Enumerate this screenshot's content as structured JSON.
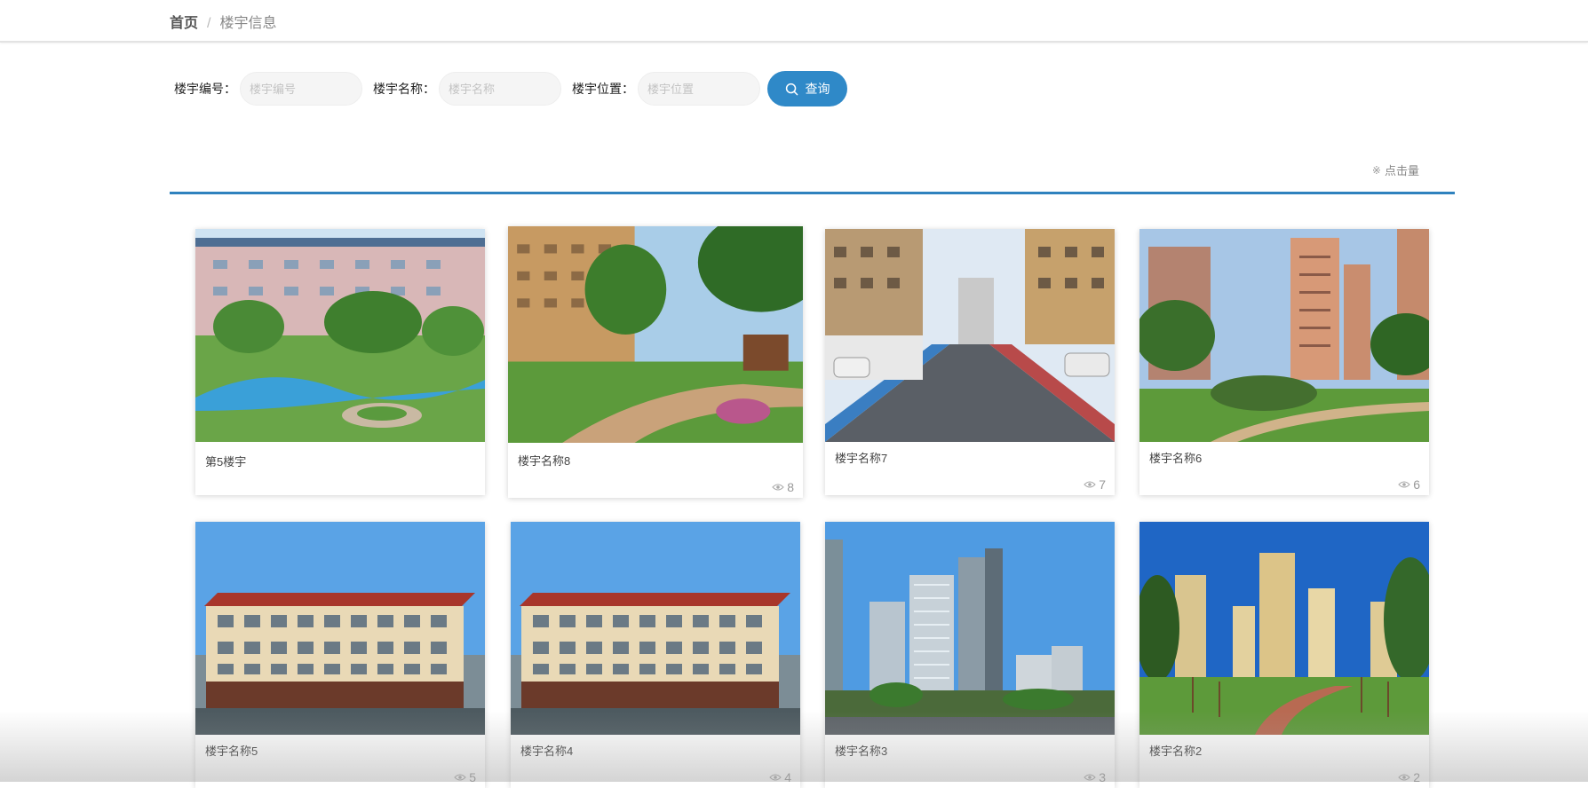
{
  "breadcrumb": {
    "home": "首页",
    "separator": "/",
    "current": "楼宇信息"
  },
  "search": {
    "fields": [
      {
        "label": "楼宇编号：",
        "placeholder": "楼宇编号",
        "value": ""
      },
      {
        "label": "楼宇名称：",
        "placeholder": "楼宇名称",
        "value": ""
      },
      {
        "label": "楼宇位置：",
        "placeholder": "楼宇位置",
        "value": ""
      }
    ],
    "button_label": "查询"
  },
  "sort": {
    "mark": "※",
    "label": "点击量"
  },
  "cards": [
    {
      "title": "第5楼宇",
      "views": ""
    },
    {
      "title": "楼宇名称8",
      "views": "8"
    },
    {
      "title": "楼宇名称7",
      "views": "7"
    },
    {
      "title": "楼宇名称6",
      "views": "6"
    },
    {
      "title": "楼宇名称5",
      "views": "5"
    },
    {
      "title": "楼宇名称4",
      "views": "4"
    },
    {
      "title": "楼宇名称3",
      "views": "3"
    },
    {
      "title": "楼宇名称2",
      "views": "2"
    }
  ],
  "colors": {
    "accent": "#2f89c8",
    "divider": "#2f82be"
  }
}
